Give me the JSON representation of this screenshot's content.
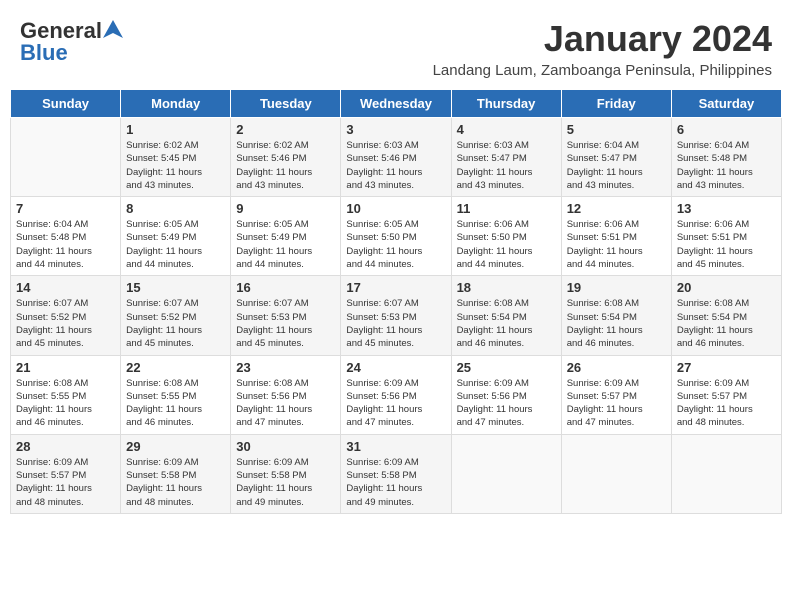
{
  "logo": {
    "general": "General",
    "blue": "Blue"
  },
  "title": "January 2024",
  "subtitle": "Landang Laum, Zamboanga Peninsula, Philippines",
  "days": [
    "Sunday",
    "Monday",
    "Tuesday",
    "Wednesday",
    "Thursday",
    "Friday",
    "Saturday"
  ],
  "weeks": [
    [
      {
        "day": "",
        "info": ""
      },
      {
        "day": "1",
        "info": "Sunrise: 6:02 AM\nSunset: 5:45 PM\nDaylight: 11 hours\nand 43 minutes."
      },
      {
        "day": "2",
        "info": "Sunrise: 6:02 AM\nSunset: 5:46 PM\nDaylight: 11 hours\nand 43 minutes."
      },
      {
        "day": "3",
        "info": "Sunrise: 6:03 AM\nSunset: 5:46 PM\nDaylight: 11 hours\nand 43 minutes."
      },
      {
        "day": "4",
        "info": "Sunrise: 6:03 AM\nSunset: 5:47 PM\nDaylight: 11 hours\nand 43 minutes."
      },
      {
        "day": "5",
        "info": "Sunrise: 6:04 AM\nSunset: 5:47 PM\nDaylight: 11 hours\nand 43 minutes."
      },
      {
        "day": "6",
        "info": "Sunrise: 6:04 AM\nSunset: 5:48 PM\nDaylight: 11 hours\nand 43 minutes."
      }
    ],
    [
      {
        "day": "7",
        "info": "Sunrise: 6:04 AM\nSunset: 5:48 PM\nDaylight: 11 hours\nand 44 minutes."
      },
      {
        "day": "8",
        "info": "Sunrise: 6:05 AM\nSunset: 5:49 PM\nDaylight: 11 hours\nand 44 minutes."
      },
      {
        "day": "9",
        "info": "Sunrise: 6:05 AM\nSunset: 5:49 PM\nDaylight: 11 hours\nand 44 minutes."
      },
      {
        "day": "10",
        "info": "Sunrise: 6:05 AM\nSunset: 5:50 PM\nDaylight: 11 hours\nand 44 minutes."
      },
      {
        "day": "11",
        "info": "Sunrise: 6:06 AM\nSunset: 5:50 PM\nDaylight: 11 hours\nand 44 minutes."
      },
      {
        "day": "12",
        "info": "Sunrise: 6:06 AM\nSunset: 5:51 PM\nDaylight: 11 hours\nand 44 minutes."
      },
      {
        "day": "13",
        "info": "Sunrise: 6:06 AM\nSunset: 5:51 PM\nDaylight: 11 hours\nand 45 minutes."
      }
    ],
    [
      {
        "day": "14",
        "info": "Sunrise: 6:07 AM\nSunset: 5:52 PM\nDaylight: 11 hours\nand 45 minutes."
      },
      {
        "day": "15",
        "info": "Sunrise: 6:07 AM\nSunset: 5:52 PM\nDaylight: 11 hours\nand 45 minutes."
      },
      {
        "day": "16",
        "info": "Sunrise: 6:07 AM\nSunset: 5:53 PM\nDaylight: 11 hours\nand 45 minutes."
      },
      {
        "day": "17",
        "info": "Sunrise: 6:07 AM\nSunset: 5:53 PM\nDaylight: 11 hours\nand 45 minutes."
      },
      {
        "day": "18",
        "info": "Sunrise: 6:08 AM\nSunset: 5:54 PM\nDaylight: 11 hours\nand 46 minutes."
      },
      {
        "day": "19",
        "info": "Sunrise: 6:08 AM\nSunset: 5:54 PM\nDaylight: 11 hours\nand 46 minutes."
      },
      {
        "day": "20",
        "info": "Sunrise: 6:08 AM\nSunset: 5:54 PM\nDaylight: 11 hours\nand 46 minutes."
      }
    ],
    [
      {
        "day": "21",
        "info": "Sunrise: 6:08 AM\nSunset: 5:55 PM\nDaylight: 11 hours\nand 46 minutes."
      },
      {
        "day": "22",
        "info": "Sunrise: 6:08 AM\nSunset: 5:55 PM\nDaylight: 11 hours\nand 46 minutes."
      },
      {
        "day": "23",
        "info": "Sunrise: 6:08 AM\nSunset: 5:56 PM\nDaylight: 11 hours\nand 47 minutes."
      },
      {
        "day": "24",
        "info": "Sunrise: 6:09 AM\nSunset: 5:56 PM\nDaylight: 11 hours\nand 47 minutes."
      },
      {
        "day": "25",
        "info": "Sunrise: 6:09 AM\nSunset: 5:56 PM\nDaylight: 11 hours\nand 47 minutes."
      },
      {
        "day": "26",
        "info": "Sunrise: 6:09 AM\nSunset: 5:57 PM\nDaylight: 11 hours\nand 47 minutes."
      },
      {
        "day": "27",
        "info": "Sunrise: 6:09 AM\nSunset: 5:57 PM\nDaylight: 11 hours\nand 48 minutes."
      }
    ],
    [
      {
        "day": "28",
        "info": "Sunrise: 6:09 AM\nSunset: 5:57 PM\nDaylight: 11 hours\nand 48 minutes."
      },
      {
        "day": "29",
        "info": "Sunrise: 6:09 AM\nSunset: 5:58 PM\nDaylight: 11 hours\nand 48 minutes."
      },
      {
        "day": "30",
        "info": "Sunrise: 6:09 AM\nSunset: 5:58 PM\nDaylight: 11 hours\nand 49 minutes."
      },
      {
        "day": "31",
        "info": "Sunrise: 6:09 AM\nSunset: 5:58 PM\nDaylight: 11 hours\nand 49 minutes."
      },
      {
        "day": "",
        "info": ""
      },
      {
        "day": "",
        "info": ""
      },
      {
        "day": "",
        "info": ""
      }
    ]
  ]
}
